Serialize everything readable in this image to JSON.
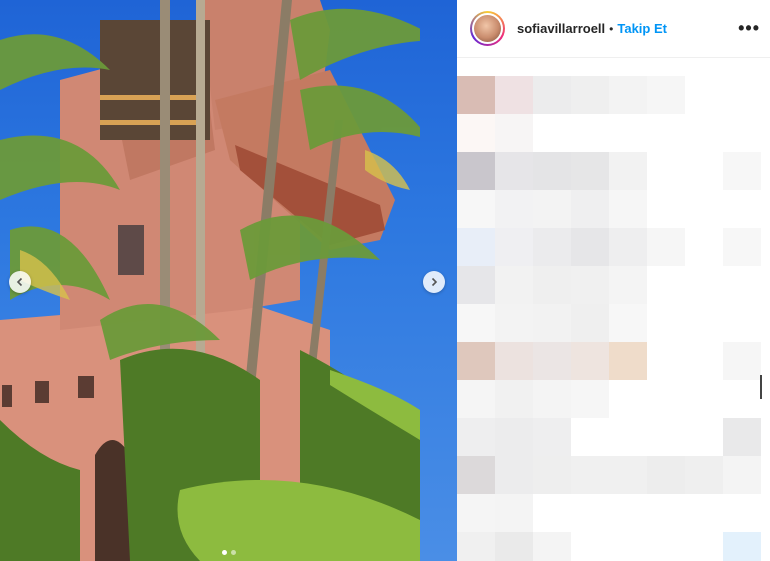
{
  "post": {
    "username": "sofiavillarroell",
    "separator": "•",
    "follow_label": "Takip Et",
    "more_label": "•••"
  },
  "media": {
    "prev_icon": "chevron-left-icon",
    "next_icon": "chevron-right-icon",
    "carousel_count": 2,
    "active_index": 1
  },
  "colors": {
    "accent": "#0095f6",
    "text": "#262626"
  }
}
